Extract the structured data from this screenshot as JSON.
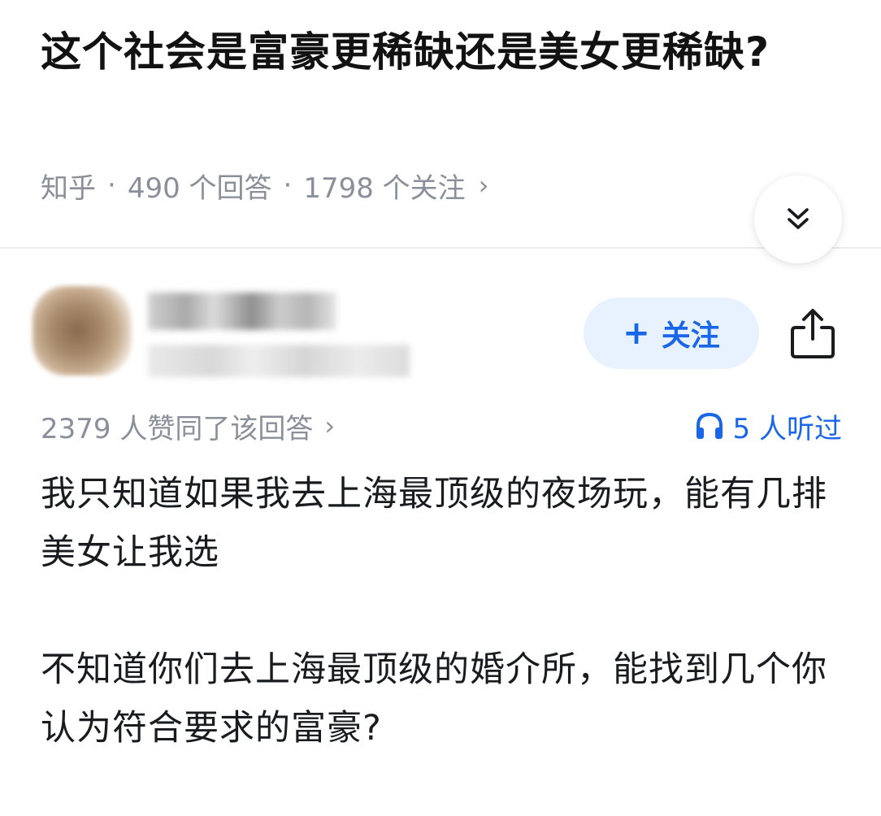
{
  "question": {
    "title": "这个社会是富豪更稀缺还是美女更稀缺?",
    "source": "知乎",
    "answers": "490 个回答",
    "followers": "1798 个关注",
    "separator": "·"
  },
  "author": {
    "follow_label": "关注"
  },
  "answer": {
    "upvotes": "2379 人赞同了该回答",
    "listened": "5 人听过",
    "paragraphs": [
      "我只知道如果我去上海最顶级的夜场玩，能有几排美女让我选",
      "不知道你们去上海最顶级的婚介所，能找到几个你认为符合要求的富豪?"
    ]
  },
  "icons": {
    "collapse": "double-chevron-down-icon",
    "share": "share-icon",
    "headphone": "headphone-icon",
    "chevron": "chevron-right-icon"
  },
  "colors": {
    "accent": "#1a66e8",
    "follow_bg": "#e8f1fe",
    "meta_text": "#8a8f99"
  }
}
